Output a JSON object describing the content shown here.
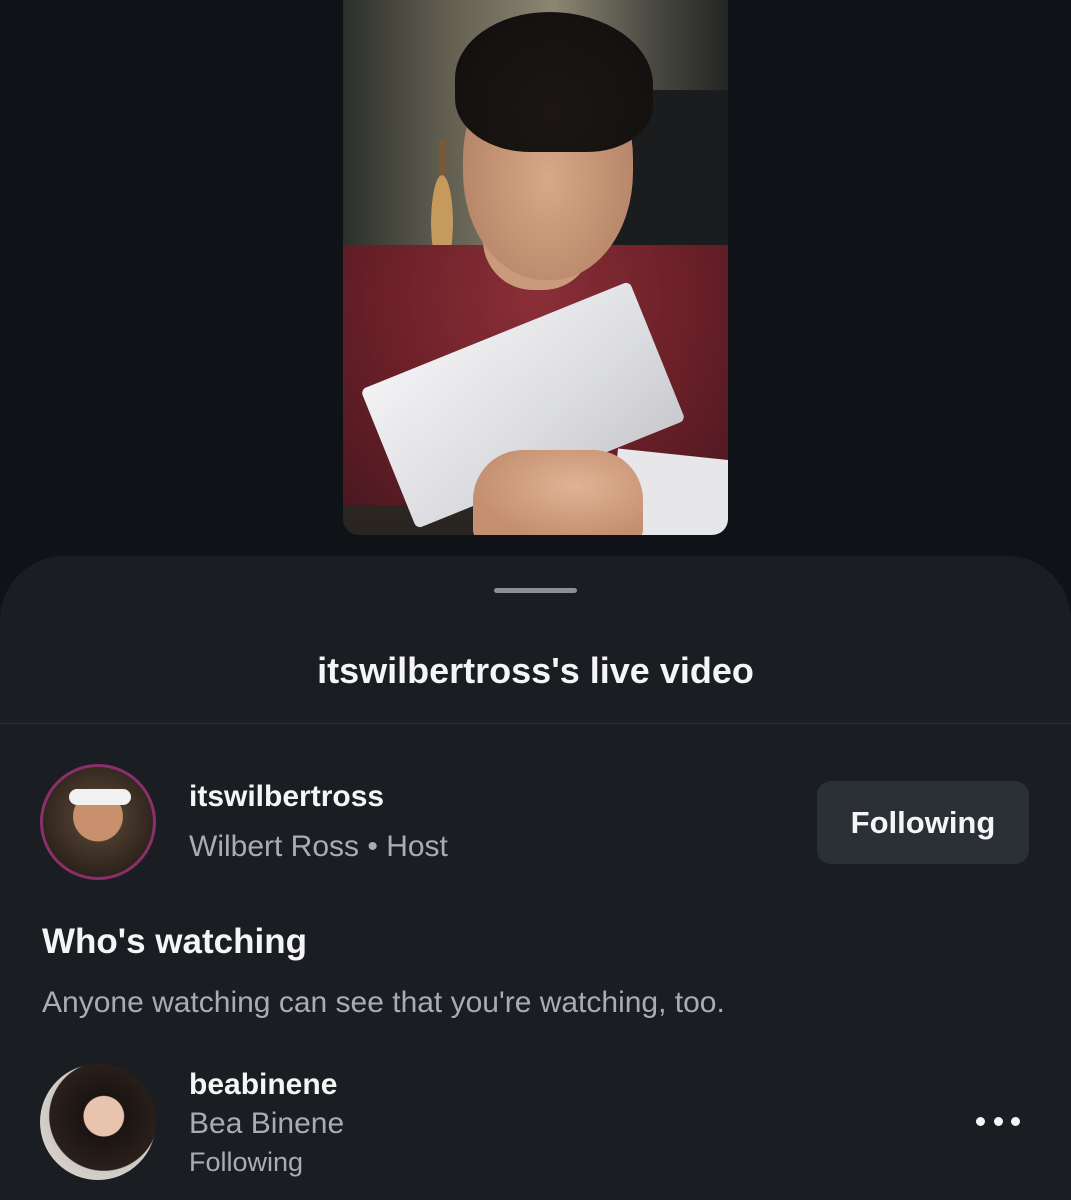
{
  "sheet": {
    "title": "itswilbertross's live video"
  },
  "host": {
    "username": "itswilbertross",
    "subtitle": "Wilbert Ross • Host",
    "follow_label": "Following"
  },
  "watching": {
    "title": "Who's watching",
    "description": "Anyone watching can see that you're watching, too."
  },
  "viewers": [
    {
      "username": "beabinene",
      "name": "Bea Binene",
      "status": "Following",
      "menu_icon": "more-horizontal-icon"
    }
  ],
  "colors": {
    "background": "#0f1216",
    "sheet": "#1a1d22",
    "button": "#2b2f36",
    "secondary_text": "#a8adb3"
  }
}
